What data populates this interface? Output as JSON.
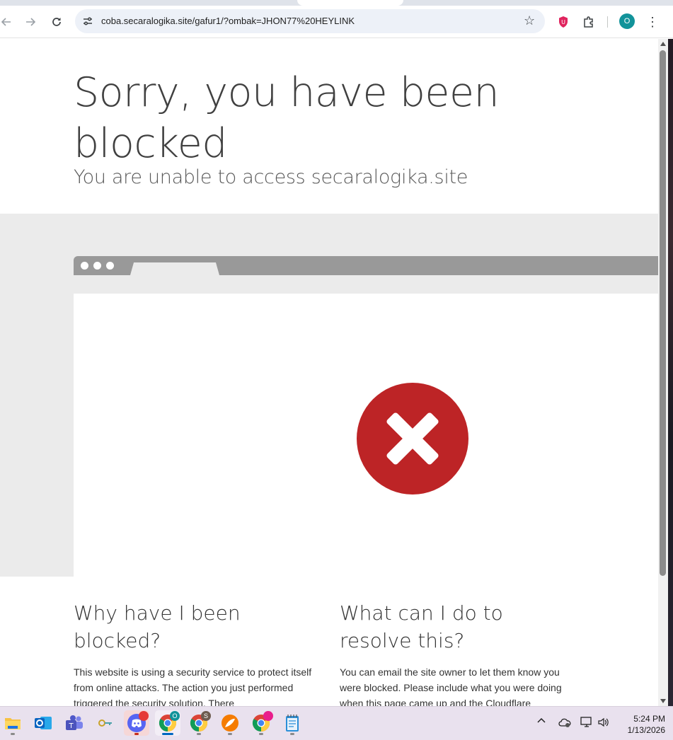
{
  "browser": {
    "url": "coba.secaralogika.site/gafur1/?ombak=JHON77%20HEYLINK",
    "profile_initial": "O",
    "icons": {
      "back": "back-arrow-icon",
      "forward": "forward-arrow-icon",
      "reload": "reload-icon",
      "site_info": "tune-icon",
      "bookmark": "star-icon",
      "extension_shield": "ublock-shield-icon",
      "extensions": "puzzle-icon",
      "menu": "more-vert-icon"
    },
    "colors": {
      "profile": "#12939a",
      "omnibox": "#edf1f8",
      "shield": "#e0245e"
    }
  },
  "page": {
    "headline": "Sorry, you have been blocked",
    "subhead": "You are unable to access secaralogika.site",
    "error_icon": "error-x-circle-icon",
    "error_color": "#bd2426",
    "why": {
      "title": "Why have I been blocked?",
      "text": "This website is using a security service to protect itself from online attacks. The action you just performed triggered the security solution. There"
    },
    "resolve": {
      "title": "What can I do to resolve this?",
      "text": "You can email the site owner to let them know you were blocked. Please include what you were doing when this page came up and the Cloudflare"
    }
  },
  "taskbar": {
    "apps": [
      {
        "name": "file-explorer-icon",
        "badge": ""
      },
      {
        "name": "outlook-icon",
        "badge": ""
      },
      {
        "name": "teams-icon",
        "badge": ""
      },
      {
        "name": "key-app-icon",
        "badge": ""
      },
      {
        "name": "discord-icon",
        "badge": ""
      },
      {
        "name": "chrome-icon",
        "badge": "O"
      },
      {
        "name": "chrome-icon",
        "badge": "S"
      },
      {
        "name": "app-sail-icon",
        "badge": ""
      },
      {
        "name": "chrome-icon",
        "badge": ""
      },
      {
        "name": "notepad-icon",
        "badge": ""
      }
    ],
    "tray": {
      "time": "5:24 PM",
      "date": "1/13/2026",
      "icons": [
        "chevron-up-icon",
        "cloud-icon",
        "network-icon",
        "volume-icon"
      ]
    }
  }
}
